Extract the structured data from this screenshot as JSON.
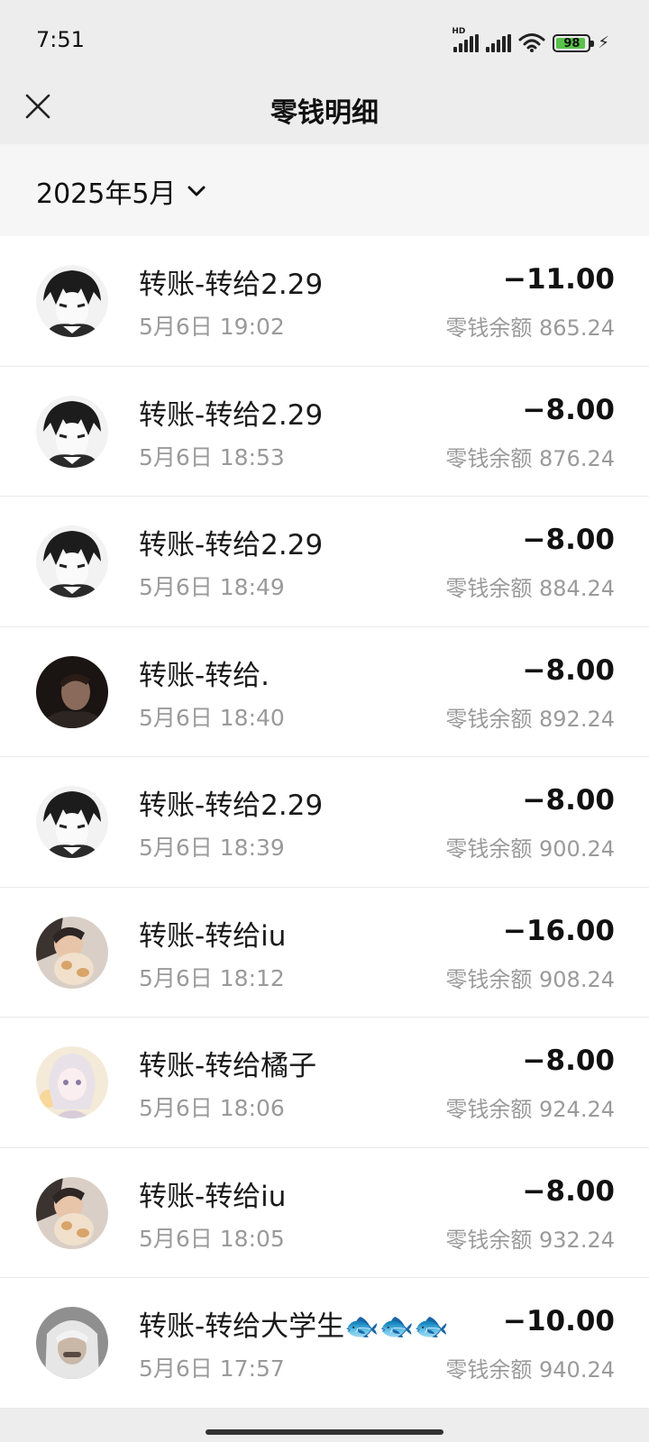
{
  "status_bar": {
    "time": "7:51",
    "battery_level": "98",
    "network_label": "HD",
    "icons": [
      "signal-icon",
      "signal-icon",
      "wifi-icon",
      "battery-icon",
      "charging-icon"
    ]
  },
  "header": {
    "title": "零钱明细",
    "close_icon": "close-icon"
  },
  "filter": {
    "month": "2025年5月",
    "icon": "chevron-down-icon"
  },
  "transactions": [
    {
      "title": "转账-转给2.29",
      "time": "5月6日 19:02",
      "amount": "−11.00",
      "balance": "零钱余额 865.24",
      "avatar": "anime-boy-avatar"
    },
    {
      "title": "转账-转给2.29",
      "time": "5月6日 18:53",
      "amount": "−8.00",
      "balance": "零钱余额 876.24",
      "avatar": "anime-boy-avatar"
    },
    {
      "title": "转账-转给2.29",
      "time": "5月6日 18:49",
      "amount": "−8.00",
      "balance": "零钱余额 884.24",
      "avatar": "anime-boy-avatar"
    },
    {
      "title": "转账-转给.",
      "time": "5月6日 18:40",
      "amount": "−8.00",
      "balance": "零钱余额 892.24",
      "avatar": "dark-photo-avatar"
    },
    {
      "title": "转账-转给2.29",
      "time": "5月6日 18:39",
      "amount": "−8.00",
      "balance": "零钱余额 900.24",
      "avatar": "anime-boy-avatar"
    },
    {
      "title": "转账-转给iu",
      "time": "5月6日 18:12",
      "amount": "−16.00",
      "balance": "零钱余额 908.24",
      "avatar": "girl-cat-avatar"
    },
    {
      "title": "转账-转给橘子",
      "time": "5月6日 18:06",
      "amount": "−8.00",
      "balance": "零钱余额 924.24",
      "avatar": "doll-avatar"
    },
    {
      "title": "转账-转给iu",
      "time": "5月6日 18:05",
      "amount": "−8.00",
      "balance": "零钱余额 932.24",
      "avatar": "girl-cat-avatar"
    },
    {
      "title": "转账-转给大学生🐟🐟🐟",
      "time": "5月6日 17:57",
      "amount": "−10.00",
      "balance": "零钱余额 940.24",
      "avatar": "hooded-person-avatar"
    }
  ],
  "colors": {
    "background": "#ededed",
    "list_background": "#ffffff",
    "secondary_text": "#9a9a9a",
    "battery_fill": "#58c24a"
  }
}
